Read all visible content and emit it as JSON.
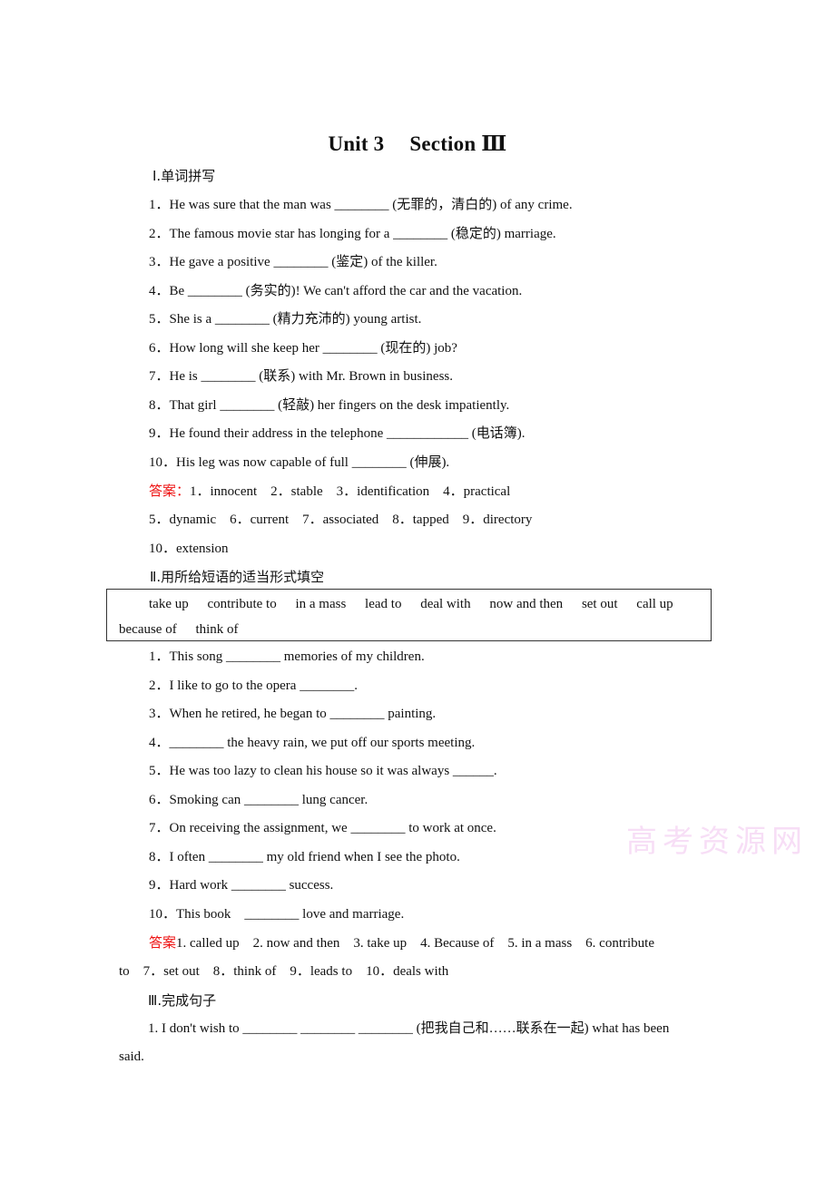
{
  "title": {
    "unit": "Unit 3",
    "section": "Section Ⅲ"
  },
  "section1": {
    "heading": "Ⅰ.单词拼写",
    "items": [
      "1．He was sure that the man was ________ (无罪的，清白的) of any crime.",
      "2．The famous movie star has longing for a ________ (稳定的) marriage.",
      "3．He gave a positive ________ (鉴定) of the killer.",
      "4．Be ________ (务实的)! We can't afford the car and the vacation.",
      "5．She is a ________ (精力充沛的) young artist.",
      "6．How long will she keep her ________ (现在的) job?",
      "7．He is ________ (联系) with Mr. Brown in business.",
      "8．That girl ________ (轻敲) her fingers on the desk impatiently.",
      "9．He found their address in the telephone ____________ (电话簿).",
      "10．His leg was now capable of full ________ (伸展)."
    ],
    "answer_label": "答案：",
    "answer_line1": "1．innocent　2．stable　3．identification　4．practical",
    "answer_line2": "5．dynamic　6．current　7．associated　8．tapped　9．directory",
    "answer_line3": "10．extension"
  },
  "section2": {
    "heading": "Ⅱ.用所给短语的适当形式填空",
    "phrases_row1": [
      "take up",
      "contribute to",
      "in a mass",
      "lead to",
      "deal with",
      "now and then",
      "set out",
      "call up"
    ],
    "phrases_row2": [
      "because of",
      "think of"
    ],
    "items": [
      "1．This song ________ memories of my children.",
      "2．I like to go to the opera ________.",
      "3．When he retired, he began to ________ painting.",
      "4．________ the heavy rain, we put off our sports meeting.",
      "5．He was too lazy to clean his house so it was always ______.",
      "6．Smoking can ________ lung cancer.",
      "7．On receiving the assignment, we ________ to work at once.",
      "8．I often ________ my old friend when I see the photo.",
      "9．Hard work ________ success.",
      "10．This book　________ love and marriage."
    ],
    "answer_label": "答案",
    "answer_line1": "1. called up　2. now and then　3. take up　4. Because of　5. in a mass　6. contribute",
    "answer_line2": "to　7．set out　8．think of　9．leads to　10．deals with"
  },
  "section3": {
    "heading": "Ⅲ.完成句子",
    "item1_line1": "1. I don't wish to ________ ________ ________ (把我自己和……联系在一起) what has been",
    "item1_line2": "said."
  },
  "watermark": "高考资源网",
  "colors": {
    "answer_label": "#ee1111",
    "watermark": "#f6d6f4"
  }
}
